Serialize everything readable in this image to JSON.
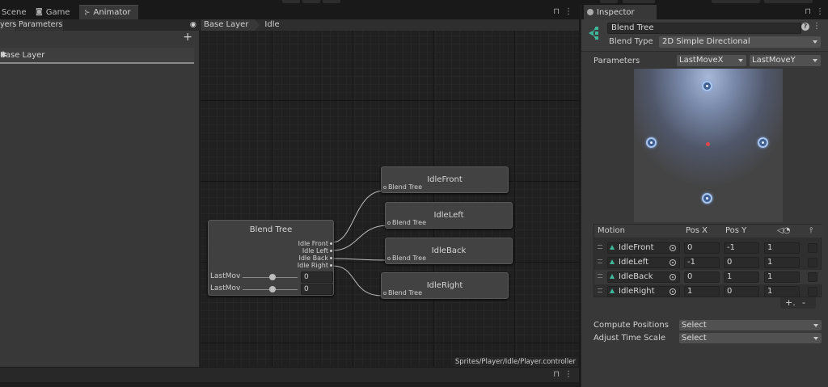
{
  "tabs": {
    "scene": "Scene",
    "game": "Game",
    "animator": "Animator"
  },
  "animator": {
    "panel_tab_layers": "yers",
    "panel_tab_parameters": "Parameters",
    "layer_name": "Base Layer",
    "breadcrumb": [
      "Base Layer",
      "Idle"
    ],
    "file_path": "Sprites/Player/Idle/Player.controller",
    "blend_tree_node": {
      "title": "Blend Tree",
      "outputs": [
        "Idle Front",
        "Idle Left",
        "Idle Back",
        "Idle Right"
      ],
      "params": [
        {
          "label": "LastMov",
          "value": "0"
        },
        {
          "label": "LastMov",
          "value": "0"
        }
      ]
    },
    "state_nodes": [
      {
        "title": "IdleFront",
        "sub": "Blend Tree"
      },
      {
        "title": "IdleLeft",
        "sub": "Blend Tree"
      },
      {
        "title": "IdleBack",
        "sub": "Blend Tree"
      },
      {
        "title": "IdleRight",
        "sub": "Blend Tree"
      }
    ]
  },
  "inspector": {
    "tab": "Inspector",
    "name": "Blend Tree",
    "blend_type_label": "Blend Type",
    "blend_type": "2D Simple Directional",
    "parameters_label": "Parameters",
    "param_x": "LastMoveX",
    "param_y": "LastMoveY",
    "motion_table": {
      "headers": {
        "motion": "Motion",
        "pos_x": "Pos X",
        "pos_y": "Pos Y"
      },
      "rows": [
        {
          "motion": "IdleFront",
          "pos_x": "0",
          "pos_y": "-1",
          "speed": "1"
        },
        {
          "motion": "IdleLeft",
          "pos_x": "-1",
          "pos_y": "0",
          "speed": "1"
        },
        {
          "motion": "IdleBack",
          "pos_x": "0",
          "pos_y": "1",
          "speed": "1"
        },
        {
          "motion": "IdleRight",
          "pos_x": "1",
          "pos_y": "0",
          "speed": "1"
        }
      ],
      "add": "+.",
      "remove": "-"
    },
    "compute_positions_label": "Compute Positions",
    "compute_positions": "Select",
    "adjust_time_label": "Adjust Time Scale",
    "adjust_time": "Select"
  },
  "colors": {
    "accent_blend_icon": "#3fb89a",
    "center_dot": "#e04848",
    "point_blue": "#3f5f90"
  }
}
